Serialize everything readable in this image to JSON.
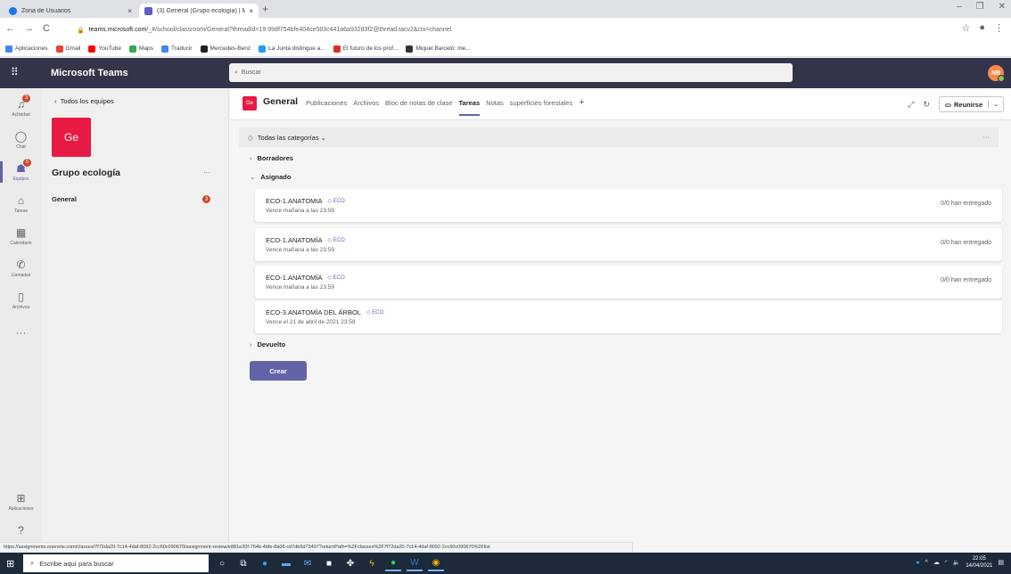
{
  "browser": {
    "tabs": [
      {
        "title": "Zona de Usuarios",
        "close": "×"
      },
      {
        "title": "(3) General (Grupo ecología) | Mi",
        "close": "×"
      }
    ],
    "new_tab": "+",
    "window_controls": [
      "–",
      "❐",
      "✕"
    ],
    "nav": [
      "←",
      "→",
      "C"
    ],
    "url_host": "teams.microsoft.com",
    "url_rest": "/_#/school/classroom/General?threadId=19:9b8f754bfe404ce583c441a6a932d3f2@thread.tacv2&ctx=channel",
    "bookmarks": [
      "Aplicaciones",
      "Gmail",
      "YouTube",
      "Maps",
      "Traducir",
      "Mercedes-Benz",
      "La Junta distingue a...",
      "El futuro de los prof...",
      "Miquel Barceló: me..."
    ],
    "status_url": "https://assignments.onenote.com/classes/7f72da20-7c14-4daf-8092-2cc60c090670/assignment-review/e881e20f-764b-4bfe-8a06-cd7db6d73497?returnPath=%2Fclasses%2F7f72da20-7c14-4daf-8092-2cc60c090670%2Flist"
  },
  "teams": {
    "brand": "Microsoft Teams",
    "search_placeholder": "Buscar",
    "avatar_initials": "NB",
    "rail": [
      {
        "label": "Actividad",
        "icon": "bell-icon",
        "badge": "3"
      },
      {
        "label": "Chat",
        "icon": "chat-icon",
        "badge": ""
      },
      {
        "label": "Equipos",
        "icon": "teams-icon",
        "badge": "5"
      },
      {
        "label": "Tareas",
        "icon": "assignments-icon",
        "badge": ""
      },
      {
        "label": "Calendario",
        "icon": "calendar-icon",
        "badge": ""
      },
      {
        "label": "Llamadas",
        "icon": "phone-icon",
        "badge": ""
      },
      {
        "label": "Archivos",
        "icon": "files-icon",
        "badge": ""
      }
    ],
    "rail_more": "···",
    "rail_apps": "Aplicaciones",
    "panel": {
      "back": "Todos los equipos",
      "team_initials": "Ge",
      "team_name": "Grupo ecología",
      "more": "···",
      "channel": "General",
      "channel_badge": "3"
    },
    "channel_header": {
      "icon": "Ge",
      "name": "General",
      "tabs": [
        "Publicaciones",
        "Archivos",
        "Bloc de notas de clase",
        "Tareas",
        "Notas",
        "superficies forestales"
      ],
      "active_tab": "Tareas",
      "meet": "Reunirse"
    },
    "filter": "Todas las categorías",
    "more": "···",
    "sections": {
      "drafts": "Borradores",
      "assigned": "Asignado",
      "returned": "Devuelto"
    },
    "assignments": [
      {
        "name": "ECO-1.ANATOMIA",
        "category": "ECO",
        "due": "Vence mañana a las 23:59",
        "status": "0/0 han entregado"
      },
      {
        "name": "ECO-1.ANATOMÍA",
        "category": "ECO",
        "due": "Vence mañana a las 23:59",
        "status": "0/0 han entregado"
      },
      {
        "name": "ECO-1.ANATOMÍA",
        "category": "ECO",
        "due": "Vence mañana a las 23:59",
        "status": "0/0 han entregado"
      },
      {
        "name": "ECO-3.ANATOMÍA DEL ÁRBOL",
        "category": "ECO",
        "due": "Vence el 21 de abril de 2021 23:59",
        "status": ""
      }
    ],
    "create_button": "Crear"
  },
  "taskbar": {
    "search_placeholder": "Escribe aquí para buscar",
    "time": "22:05",
    "date": "14/04/2021"
  },
  "colors": {
    "teams_header": "#33344a",
    "accent": "#6264a7",
    "team_avatar": "#e81b44",
    "badge": "#cc4a31"
  }
}
